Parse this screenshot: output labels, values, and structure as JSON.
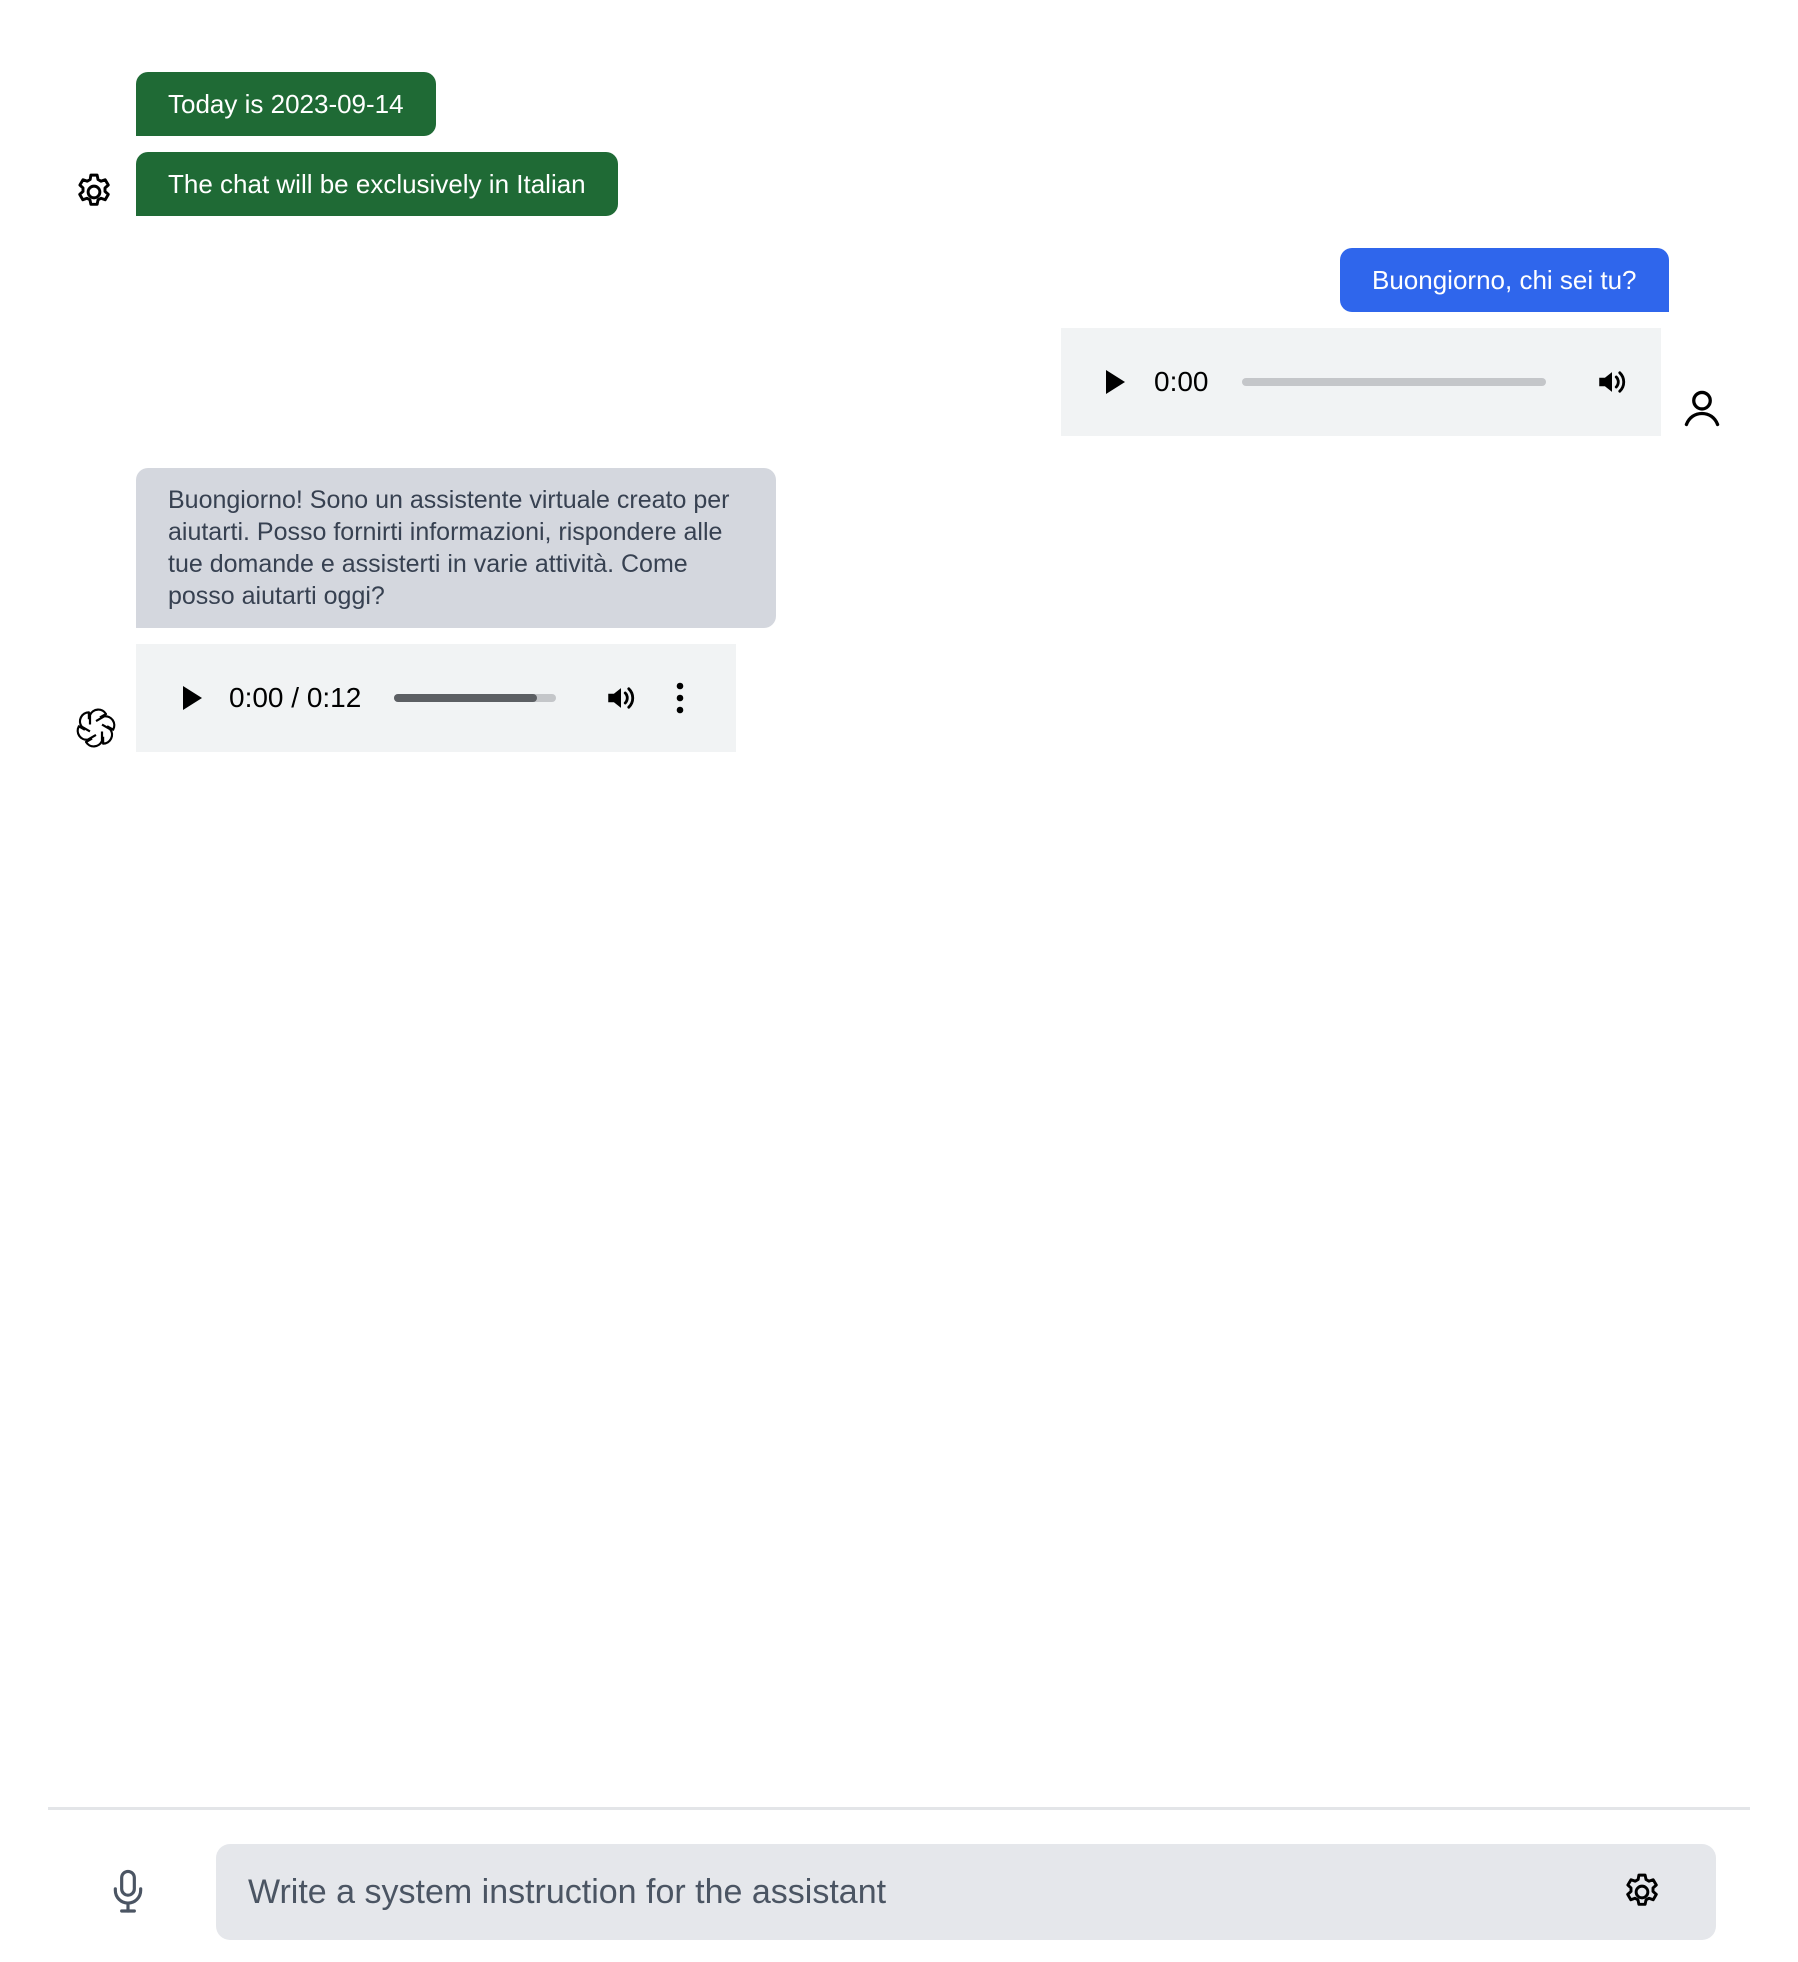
{
  "messages": {
    "system": [
      {
        "text": "Today is 2023-09-14"
      },
      {
        "text": "The chat will be exclusively in Italian"
      }
    ],
    "user": {
      "text": "Buongiorno, chi sei tu?",
      "audio": {
        "time": "0:00",
        "progress": 0
      }
    },
    "assistant": {
      "text": "Buongiorno! Sono un assistente virtuale creato per aiutarti. Posso fornirti informazioni, rispondere alle tue domande e assisterti in varie attività. Come posso aiutarti oggi?",
      "audio": {
        "time": "0:00 / 0:12",
        "buffered": 0.88,
        "progress": 0
      }
    }
  },
  "icons": {
    "system_avatar": "gear-icon",
    "user_avatar": "user-icon",
    "assistant_avatar": "openai-logo-icon",
    "mic": "microphone-icon",
    "composer_settings": "gear-icon",
    "play": "play-icon",
    "volume": "volume-icon",
    "more": "more-vertical-icon"
  },
  "composer": {
    "placeholder": "Write a system instruction for the assistant",
    "value": ""
  },
  "colors": {
    "system_bubble": "#1f6a35",
    "user_bubble": "#2f66ec",
    "assistant_bubble": "#d4d7de",
    "composer_bg": "#e5e7eb",
    "audio_bg": "#f1f3f4"
  }
}
